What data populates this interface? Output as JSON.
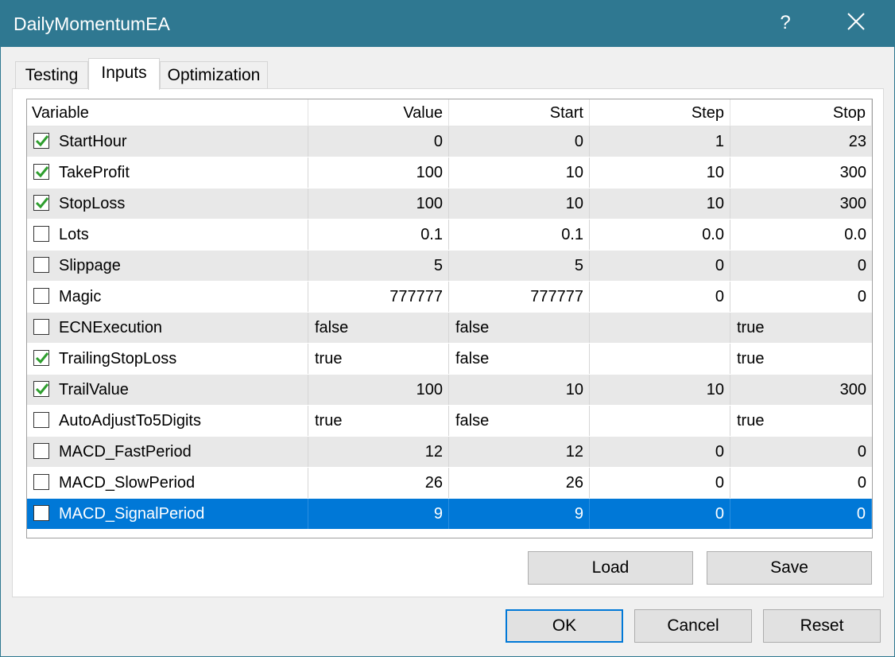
{
  "window": {
    "title": "DailyMomentumEA",
    "help_label": "?"
  },
  "tabs": [
    {
      "label": "Testing",
      "active": false
    },
    {
      "label": "Inputs",
      "active": true
    },
    {
      "label": "Optimization",
      "active": false
    }
  ],
  "grid": {
    "columns": [
      "Variable",
      "Value",
      "Start",
      "Step",
      "Stop"
    ],
    "rows": [
      {
        "checked": true,
        "variable": "StartHour",
        "value": "0",
        "start": "0",
        "step": "1",
        "stop": "23",
        "kind": "num"
      },
      {
        "checked": true,
        "variable": "TakeProfit",
        "value": "100",
        "start": "10",
        "step": "10",
        "stop": "300",
        "kind": "num"
      },
      {
        "checked": true,
        "variable": "StopLoss",
        "value": "100",
        "start": "10",
        "step": "10",
        "stop": "300",
        "kind": "num"
      },
      {
        "checked": false,
        "variable": "Lots",
        "value": "0.1",
        "start": "0.1",
        "step": "0.0",
        "stop": "0.0",
        "kind": "num"
      },
      {
        "checked": false,
        "variable": "Slippage",
        "value": "5",
        "start": "5",
        "step": "0",
        "stop": "0",
        "kind": "num"
      },
      {
        "checked": false,
        "variable": "Magic",
        "value": "777777",
        "start": "777777",
        "step": "0",
        "stop": "0",
        "kind": "num"
      },
      {
        "checked": false,
        "variable": "ECNExecution",
        "value": "false",
        "start": "false",
        "step": "",
        "stop": "true",
        "kind": "bool"
      },
      {
        "checked": true,
        "variable": "TrailingStopLoss",
        "value": "true",
        "start": "false",
        "step": "",
        "stop": "true",
        "kind": "bool"
      },
      {
        "checked": true,
        "variable": "TrailValue",
        "value": "100",
        "start": "10",
        "step": "10",
        "stop": "300",
        "kind": "num"
      },
      {
        "checked": false,
        "variable": "AutoAdjustTo5Digits",
        "value": "true",
        "start": "false",
        "step": "",
        "stop": "true",
        "kind": "bool"
      },
      {
        "checked": false,
        "variable": "MACD_FastPeriod",
        "value": "12",
        "start": "12",
        "step": "0",
        "stop": "0",
        "kind": "num"
      },
      {
        "checked": false,
        "variable": "MACD_SlowPeriod",
        "value": "26",
        "start": "26",
        "step": "0",
        "stop": "0",
        "kind": "num"
      },
      {
        "checked": false,
        "variable": "MACD_SignalPeriod",
        "value": "9",
        "start": "9",
        "step": "0",
        "stop": "0",
        "kind": "num",
        "selected": true
      }
    ]
  },
  "buttons": {
    "load": "Load",
    "save": "Save",
    "ok": "OK",
    "cancel": "Cancel",
    "reset": "Reset"
  },
  "colors": {
    "titlebar": "#2f7891",
    "selection": "#0078d7",
    "check": "#2e9e2e"
  },
  "icons": {
    "close": "close-icon",
    "check": "checkmark-icon"
  }
}
